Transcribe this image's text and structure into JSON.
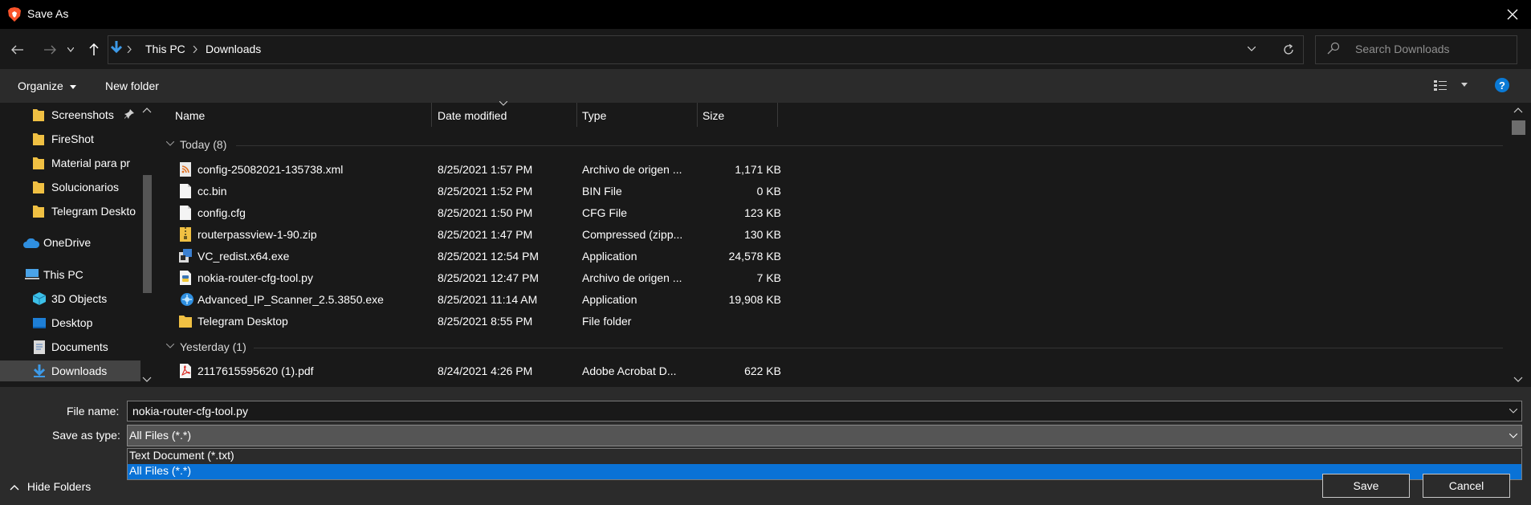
{
  "window": {
    "title": "Save As"
  },
  "address": {
    "breadcrumb": [
      "This PC",
      "Downloads"
    ],
    "search_placeholder": "Search Downloads"
  },
  "toolbar": {
    "organize": "Organize",
    "new_folder": "New folder",
    "help": "?"
  },
  "nav": {
    "quick_access": [
      "Screenshots",
      "FireShot",
      "Material para pr",
      "Solucionarios",
      "Telegram Deskto"
    ],
    "onedrive": "OneDrive",
    "this_pc": "This PC",
    "this_pc_items": [
      "3D Objects",
      "Desktop",
      "Documents",
      "Downloads"
    ]
  },
  "columns": {
    "name": "Name",
    "date": "Date modified",
    "type": "Type",
    "size": "Size"
  },
  "groups": [
    {
      "label": "Today (8)",
      "files": [
        {
          "name": "config-25082021-135738.xml",
          "date": "8/25/2021 1:57 PM",
          "type": "Archivo de origen ...",
          "size": "1,171 KB",
          "icon": "xml-file-icon"
        },
        {
          "name": "cc.bin",
          "date": "8/25/2021 1:52 PM",
          "type": "BIN File",
          "size": "0 KB",
          "icon": "file-icon"
        },
        {
          "name": "config.cfg",
          "date": "8/25/2021 1:50 PM",
          "type": "CFG File",
          "size": "123 KB",
          "icon": "file-icon"
        },
        {
          "name": "routerpassview-1-90.zip",
          "date": "8/25/2021 1:47 PM",
          "type": "Compressed (zipp...",
          "size": "130 KB",
          "icon": "zip-icon"
        },
        {
          "name": "VC_redist.x64.exe",
          "date": "8/25/2021 12:54 PM",
          "type": "Application",
          "size": "24,578 KB",
          "icon": "installer-icon"
        },
        {
          "name": "nokia-router-cfg-tool.py",
          "date": "8/25/2021 12:47 PM",
          "type": "Archivo de origen ...",
          "size": "7 KB",
          "icon": "python-file-icon"
        },
        {
          "name": "Advanced_IP_Scanner_2.5.3850.exe",
          "date": "8/25/2021 11:14 AM",
          "type": "Application",
          "size": "19,908 KB",
          "icon": "scanner-app-icon"
        },
        {
          "name": "Telegram Desktop",
          "date": "8/25/2021 8:55 PM",
          "type": "File folder",
          "size": "",
          "icon": "folder-icon"
        }
      ]
    },
    {
      "label": "Yesterday (1)",
      "files": [
        {
          "name": "2117615595620 (1).pdf",
          "date": "8/24/2021 4:26 PM",
          "type": "Adobe Acrobat D...",
          "size": "622 KB",
          "icon": "pdf-icon"
        }
      ]
    }
  ],
  "form": {
    "file_name_label": "File name:",
    "file_name_value": "nokia-router-cfg-tool.py",
    "save_type_label": "Save as type:",
    "save_type_value": "All Files (*.*)",
    "save_type_options": [
      "Text Document (*.txt)",
      "All Files (*.*)"
    ]
  },
  "footer": {
    "hide_folders": "Hide Folders",
    "save": "Save",
    "cancel": "Cancel"
  },
  "colors": {
    "accent": "#0a72d6",
    "background": "#191919",
    "panel": "#2b2b2b"
  }
}
